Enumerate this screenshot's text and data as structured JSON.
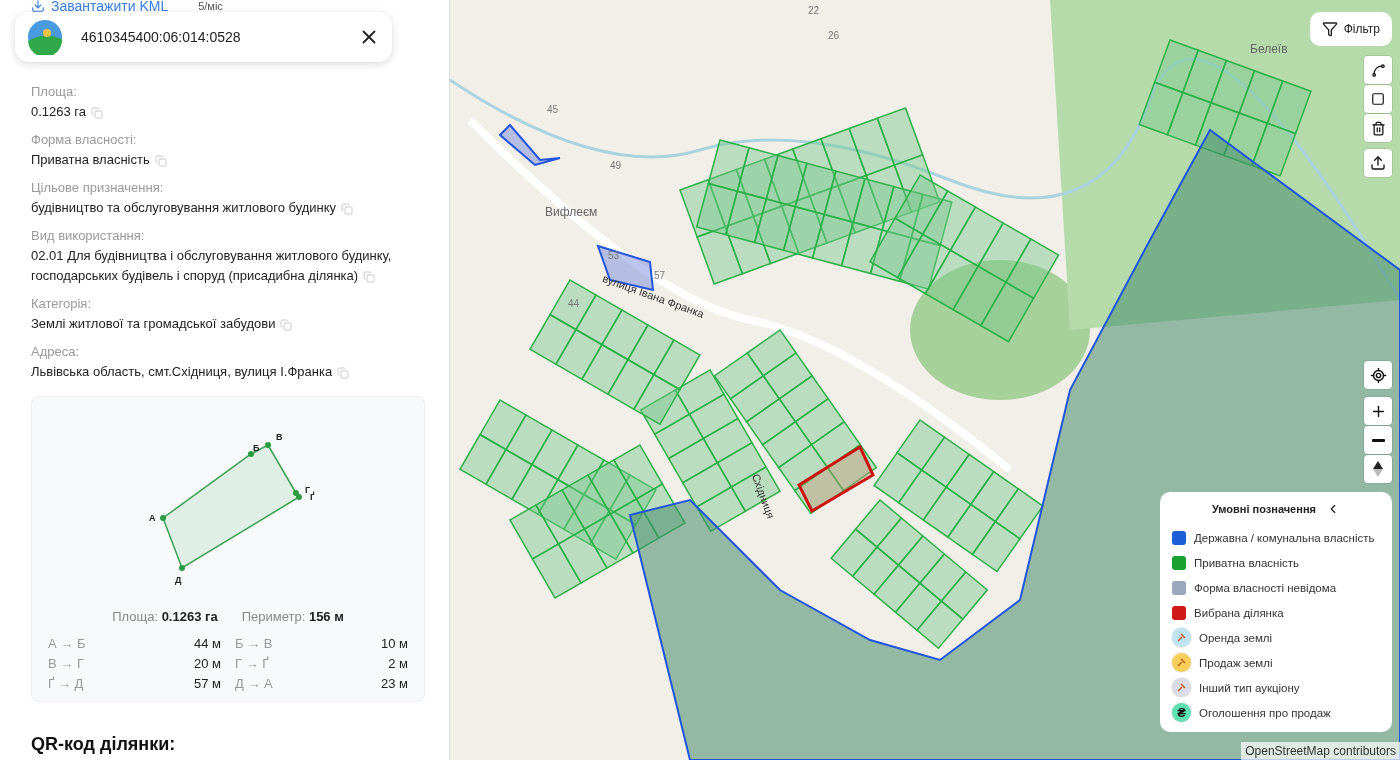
{
  "panel": {
    "download_link": "Завантажити KML",
    "download_note": "5/міс",
    "fields": [
      {
        "label": "Площа:",
        "value": "0.1263 га"
      },
      {
        "label": "Форма власності:",
        "value": "Приватна власність"
      },
      {
        "label": "Цільове призначення:",
        "value": "будівництво та обслуговування житлового будинку"
      },
      {
        "label": "Вид використання:",
        "value": "02.01 Для будівництва і обслуговування житлового будинку, господарських будівель і споруд (присадибна ділянка)"
      },
      {
        "label": "Категорія:",
        "value": "Землі житлової та громадської забудови"
      },
      {
        "label": "Адреса:",
        "value": "Львівська область, смт.Східниця, вулиця І.Франка"
      }
    ],
    "shape": {
      "vertices": [
        "А",
        "Б",
        "В",
        "Г",
        "Ґ",
        "Д"
      ],
      "area_label": "Площа:",
      "area_value": "0.1263 га",
      "perimeter_label": "Периметр:",
      "perimeter_value": "156 м",
      "edges": [
        {
          "label": "А → Б",
          "length": "44 м"
        },
        {
          "label": "Б → В",
          "length": "10 м"
        },
        {
          "label": "В → Г",
          "length": "20 м"
        },
        {
          "label": "Г → Ґ",
          "length": "2 м"
        },
        {
          "label": "Ґ → Д",
          "length": "57 м"
        },
        {
          "label": "Д → А",
          "length": "23 м"
        }
      ]
    },
    "qr_heading": "QR-код ділянки:"
  },
  "search": {
    "value": "4610345400:06:014:0528"
  },
  "map": {
    "filter_button": "Фільтр",
    "labels": [
      {
        "text": "22",
        "kind": "house"
      },
      {
        "text": "26",
        "kind": "house"
      },
      {
        "text": "Белеїв",
        "kind": "place"
      },
      {
        "text": "45",
        "kind": "house"
      },
      {
        "text": "49",
        "kind": "house"
      },
      {
        "text": "Вифлеєм",
        "kind": "place"
      },
      {
        "text": "53",
        "kind": "house"
      },
      {
        "text": "57",
        "kind": "house"
      },
      {
        "text": "вулиця Івана Франка",
        "kind": "street"
      },
      {
        "text": "44",
        "kind": "house"
      },
      {
        "text": "Східниця",
        "kind": "street"
      }
    ],
    "legend": {
      "title": "Умовні позначення",
      "items": [
        {
          "kind": "square",
          "color": "#1a5fd6",
          "label": "Державна / комунальна власність"
        },
        {
          "kind": "square",
          "color": "#18a030",
          "label": "Приватна власність"
        },
        {
          "kind": "square",
          "color": "#9aa8c0",
          "label": "Форма власності невідома"
        },
        {
          "kind": "square",
          "color": "#d01818",
          "label": "Вибрана ділянка"
        },
        {
          "kind": "auction",
          "color": "#bfe3f0",
          "label": "Оренда землі"
        },
        {
          "kind": "auction",
          "color": "#f7cf5a",
          "label": "Продаж землі"
        },
        {
          "kind": "auction",
          "color": "#dcdce6",
          "label": "Інший тип аукціону"
        },
        {
          "kind": "symbol",
          "color": "#5fe0b0",
          "symbol": "₴",
          "label": "Оголошення про продаж"
        }
      ]
    },
    "attribution": "OpenStreetMap contributors"
  }
}
